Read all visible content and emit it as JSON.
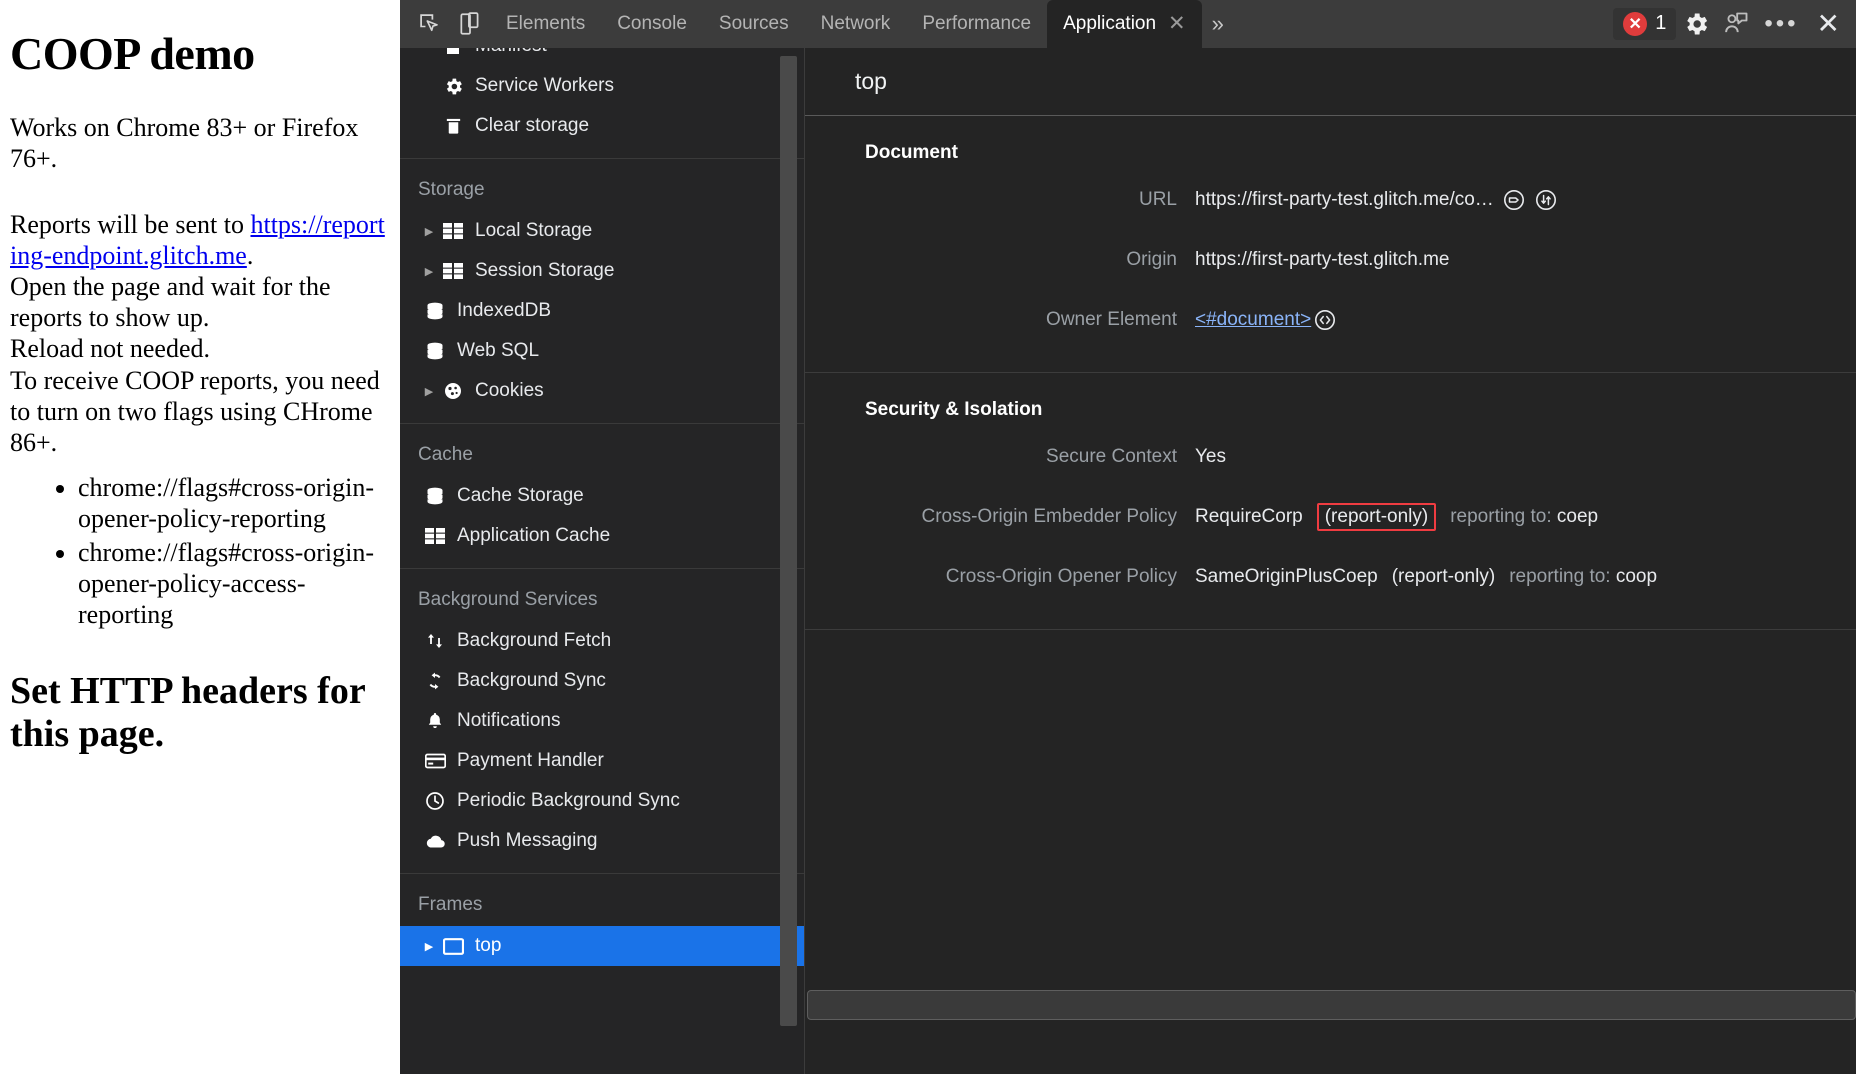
{
  "webpage": {
    "title": "COOP demo",
    "para1": "Works on Chrome 83+ or Firefox 76+.",
    "para2_pre": "Reports will be sent to ",
    "link_text": "https://reporting-endpoint.glitch.me",
    "para2_post": ".",
    "lines": [
      "Open the page and wait for the reports to show up.",
      "Reload not needed.",
      "To receive COOP reports, you need to turn on two flags using CHrome 86+."
    ],
    "bullets": [
      "chrome://flags#cross-origin-opener-policy-reporting",
      "chrome://flags#cross-origin-opener-policy-access-reporting"
    ],
    "heading2": "Set HTTP headers for this page."
  },
  "devtools": {
    "toolbar": {
      "inspect_icon": "inspect-element-icon",
      "device_icon": "device-toolbar-icon",
      "tabs": [
        {
          "label": "Elements",
          "active": false
        },
        {
          "label": "Console",
          "active": false
        },
        {
          "label": "Sources",
          "active": false
        },
        {
          "label": "Network",
          "active": false
        },
        {
          "label": "Performance",
          "active": false
        },
        {
          "label": "Application",
          "active": true
        }
      ],
      "more_tabs_icon": "chevron-double-right-icon",
      "error_count": "1",
      "error_icon": "error-circle-icon",
      "settings_icon": "gear-icon",
      "feedback_icon": "feedback-person-icon",
      "more_options_icon": "kebab-dots-icon",
      "close_icon": "close-icon"
    },
    "sidebar": {
      "groups": [
        {
          "header": "",
          "items": [
            {
              "label": "Manifest",
              "icon": "manifest-file-icon",
              "arrow": false,
              "selected": false
            },
            {
              "label": "Service Workers",
              "icon": "gear-icon",
              "arrow": false,
              "selected": false
            },
            {
              "label": "Clear storage",
              "icon": "trash-icon",
              "arrow": false,
              "selected": false
            }
          ]
        },
        {
          "header": "Storage",
          "items": [
            {
              "label": "Local Storage",
              "icon": "table-icon",
              "arrow": true,
              "selected": false
            },
            {
              "label": "Session Storage",
              "icon": "table-icon",
              "arrow": true,
              "selected": false
            },
            {
              "label": "IndexedDB",
              "icon": "database-icon",
              "arrow": false,
              "selected": false
            },
            {
              "label": "Web SQL",
              "icon": "database-icon",
              "arrow": false,
              "selected": false
            },
            {
              "label": "Cookies",
              "icon": "cookie-icon",
              "arrow": true,
              "selected": false
            }
          ]
        },
        {
          "header": "Cache",
          "items": [
            {
              "label": "Cache Storage",
              "icon": "database-icon",
              "arrow": false,
              "selected": false
            },
            {
              "label": "Application Cache",
              "icon": "table-icon",
              "arrow": false,
              "selected": false
            }
          ]
        },
        {
          "header": "Background Services",
          "items": [
            {
              "label": "Background Fetch",
              "icon": "arrows-up-down-icon",
              "arrow": false,
              "selected": false
            },
            {
              "label": "Background Sync",
              "icon": "sync-icon",
              "arrow": false,
              "selected": false
            },
            {
              "label": "Notifications",
              "icon": "bell-icon",
              "arrow": false,
              "selected": false
            },
            {
              "label": "Payment Handler",
              "icon": "credit-card-icon",
              "arrow": false,
              "selected": false
            },
            {
              "label": "Periodic Background Sync",
              "icon": "clock-icon",
              "arrow": false,
              "selected": false
            },
            {
              "label": "Push Messaging",
              "icon": "cloud-icon",
              "arrow": false,
              "selected": false
            }
          ]
        },
        {
          "header": "Frames",
          "items": [
            {
              "label": "top",
              "icon": "frame-icon",
              "arrow": true,
              "selected": true
            }
          ]
        }
      ]
    },
    "main": {
      "title": "top",
      "sections": [
        {
          "title": "Document",
          "rows": [
            {
              "label": "URL",
              "value": "https://first-party-test.glitch.me/co…",
              "icons": [
                "url-label-circle-icon",
                "scroll-into-view-circle-icon"
              ],
              "link": false
            },
            {
              "label": "Origin",
              "value": "https://first-party-test.glitch.me",
              "icons": [],
              "link": false
            },
            {
              "label": "Owner Element",
              "value": "<#document>",
              "icons": [
                "reveal-code-circle-icon"
              ],
              "link": true
            }
          ]
        },
        {
          "title": "Security & Isolation",
          "rows": [
            {
              "label": "Secure Context",
              "value": "Yes",
              "icons": [],
              "link": false
            },
            {
              "label": "Cross-Origin Embedder Policy",
              "value": "RequireCorp",
              "badge": "(report-only)",
              "badge_highlighted": true,
              "reporting": "reporting to: ",
              "reporting_target": "coep",
              "icons": [],
              "link": false
            },
            {
              "label": "Cross-Origin Opener Policy",
              "value": "SameOriginPlusCoep",
              "badge": "(report-only)",
              "badge_highlighted": false,
              "reporting": "reporting to: ",
              "reporting_target": "coop",
              "icons": [],
              "link": false
            }
          ]
        }
      ]
    },
    "colors": {
      "accent_blue": "#1a73e8",
      "link_blue": "#8ab4f8",
      "error_red": "#e03c3c",
      "highlight_red": "#f03c41",
      "panel_bg": "#242424",
      "sidebar_bg": "#252526",
      "toolbar_bg": "#3c3c3c"
    }
  }
}
